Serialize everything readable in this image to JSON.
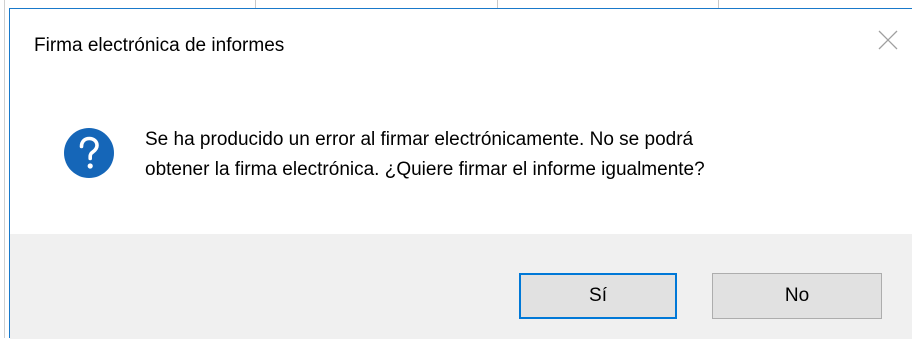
{
  "dialog": {
    "title": "Firma electrónica de informes",
    "message_line1": "Se ha producido un error al firmar electrónicamente. No se podrá",
    "message_line2": "obtener la firma electrónica. ¿Quiere firmar el informe igualmente?",
    "icon": "question-icon",
    "close_icon": "close-icon",
    "buttons": {
      "yes_label": "Sí",
      "no_label": "No",
      "default": "yes"
    }
  },
  "colors": {
    "icon_blue": "#1566b8",
    "border_accent": "#1979ca",
    "default_button_border": "#0078d7",
    "footer_bg": "#f0f0f0",
    "button_bg": "#e1e1e1"
  }
}
